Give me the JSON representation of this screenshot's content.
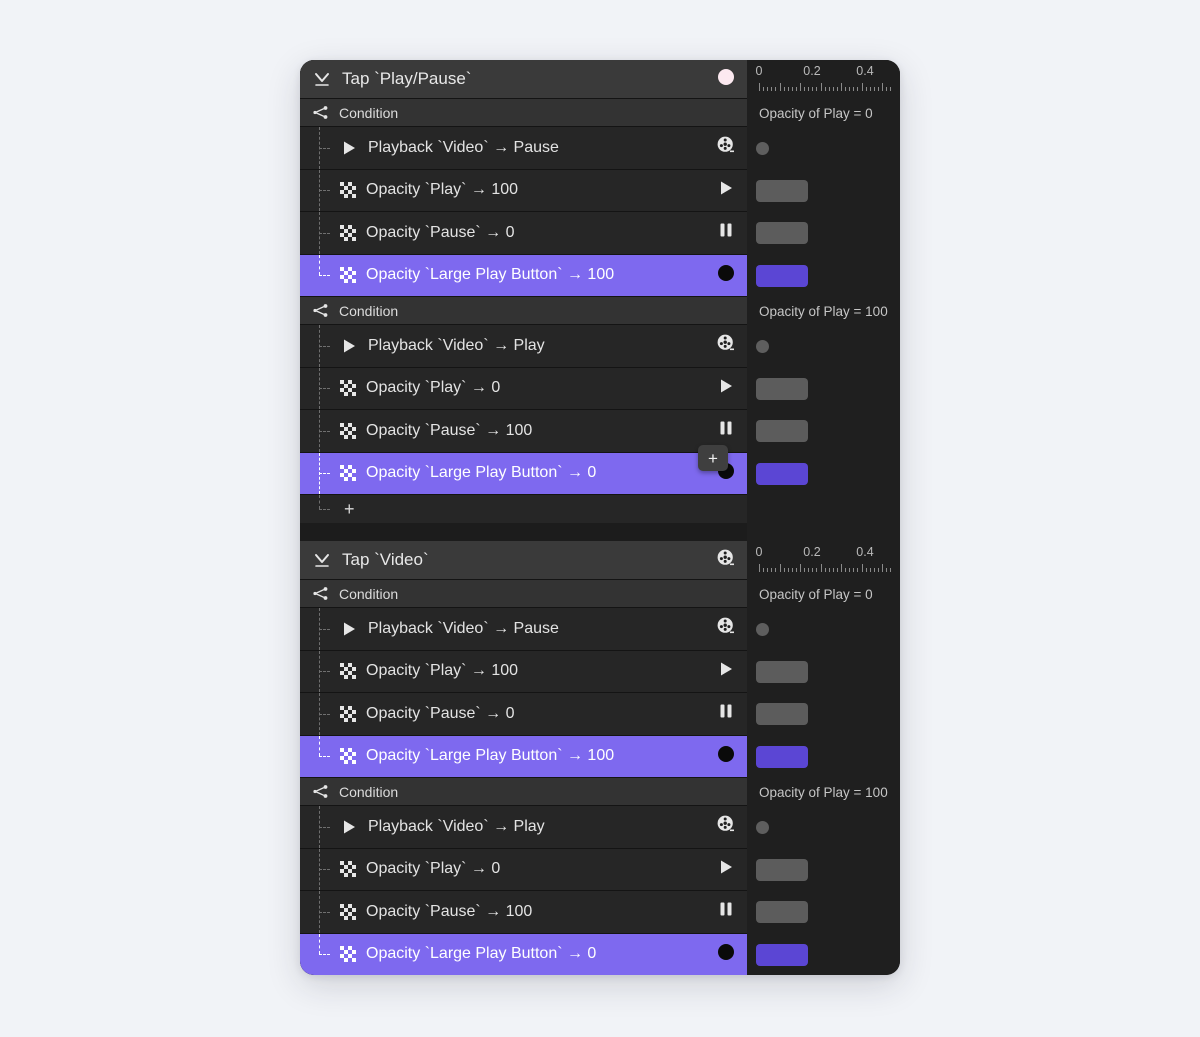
{
  "panel": {
    "background": "#1c1c1c",
    "accent_color": "#7e69ef",
    "bar_accent_color": "#5b46d4",
    "bar_color": "#5c5c5c"
  },
  "float_plus": {
    "label": "+"
  },
  "blocks": [
    {
      "header": {
        "icon": "tap-icon",
        "label": "Tap `Play/Pause`",
        "right_icon": "tap-target-dot-icon"
      },
      "groups": [
        {
          "condition_label": "Condition",
          "timeline_caption": "Opacity of Play = 0",
          "rows": [
            {
              "icon": "play-triangle-icon",
              "label": "Playback `Video` → Pause",
              "right_icon": "film-reel-icon",
              "selected": false,
              "track": "dot"
            },
            {
              "icon": "opacity-checker-icon",
              "label": "Opacity `Play` → 100",
              "right_icon": "play-triangle-icon",
              "selected": false,
              "track": "bar"
            },
            {
              "icon": "opacity-checker-icon",
              "label": "Opacity `Pause` → 0",
              "right_icon": "pause-bars-icon",
              "selected": false,
              "track": "bar"
            },
            {
              "icon": "opacity-checker-icon",
              "label": "Opacity `Large Play Button` → 100",
              "right_icon": "black-dot-icon",
              "selected": true,
              "track": "bar"
            }
          ]
        },
        {
          "condition_label": "Condition",
          "timeline_caption": "Opacity of Play = 100",
          "rows": [
            {
              "icon": "play-triangle-icon",
              "label": "Playback `Video` → Play",
              "right_icon": "film-reel-icon",
              "selected": false,
              "track": "dot"
            },
            {
              "icon": "opacity-checker-icon",
              "label": "Opacity `Play` → 0",
              "right_icon": "play-triangle-icon",
              "selected": false,
              "track": "bar"
            },
            {
              "icon": "opacity-checker-icon",
              "label": "Opacity `Pause` → 100",
              "right_icon": "pause-bars-icon",
              "selected": false,
              "track": "bar"
            },
            {
              "icon": "opacity-checker-icon",
              "label": "Opacity `Large Play Button` → 0",
              "right_icon": "black-dot-icon",
              "selected": true,
              "track": "bar"
            }
          ]
        }
      ],
      "add_label": "+"
    },
    {
      "header": {
        "icon": "tap-icon",
        "label": "Tap `Video`",
        "right_icon": "film-reel-icon"
      },
      "groups": [
        {
          "condition_label": "Condition",
          "timeline_caption": "Opacity of Play = 0",
          "rows": [
            {
              "icon": "play-triangle-icon",
              "label": "Playback `Video` → Pause",
              "right_icon": "film-reel-icon",
              "selected": false,
              "track": "dot"
            },
            {
              "icon": "opacity-checker-icon",
              "label": "Opacity `Play` → 100",
              "right_icon": "play-triangle-icon",
              "selected": false,
              "track": "bar"
            },
            {
              "icon": "opacity-checker-icon",
              "label": "Opacity `Pause` → 0",
              "right_icon": "pause-bars-icon",
              "selected": false,
              "track": "bar"
            },
            {
              "icon": "opacity-checker-icon",
              "label": "Opacity `Large Play Button` → 100",
              "right_icon": "black-dot-icon",
              "selected": true,
              "track": "bar"
            }
          ]
        },
        {
          "condition_label": "Condition",
          "timeline_caption": "Opacity of Play = 100",
          "rows": [
            {
              "icon": "play-triangle-icon",
              "label": "Playback `Video` → Play",
              "right_icon": "film-reel-icon",
              "selected": false,
              "track": "dot"
            },
            {
              "icon": "opacity-checker-icon",
              "label": "Opacity `Play` → 0",
              "right_icon": "play-triangle-icon",
              "selected": false,
              "track": "bar"
            },
            {
              "icon": "opacity-checker-icon",
              "label": "Opacity `Pause` → 100",
              "right_icon": "pause-bars-icon",
              "selected": false,
              "track": "bar"
            },
            {
              "icon": "opacity-checker-icon",
              "label": "Opacity `Large Play Button` → 0",
              "right_icon": "black-dot-icon",
              "selected": true,
              "track": "bar"
            }
          ]
        }
      ],
      "add_label": ""
    }
  ],
  "ruler": {
    "tick_labels": [
      "0",
      "0.2",
      "0.4"
    ],
    "tick_label_positions": [
      12,
      65,
      118
    ],
    "minor_tick_count": 33,
    "major_every": 5
  }
}
